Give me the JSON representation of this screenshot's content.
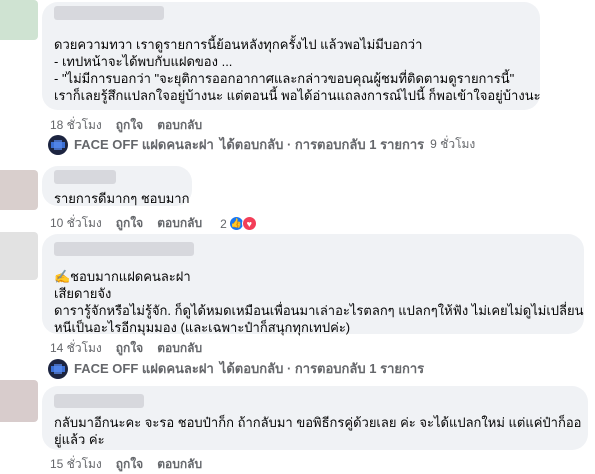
{
  "comments": [
    {
      "lines": [
        "ดวยความทวา เราดูรายการนี้ย้อนหลังทุกครั้งไป แล้วพอไม่มีบอกว่า",
        "- เทปหน้าจะได้พบกับแฝดของ ...",
        "- \"ไม่มีการบอกว่า \"จะยุติการออกอากาศและกล่าวขอบคุณผู้ชมที่ติดตามดูรายการนี้\"",
        "เราก็เลยรู้สึกแปลกใจอยู่บ้างนะ แต่ตอนนี้ พอได้อ่านแถลงการณ์ไปนี้ ก็พอเข้าใจอยู่บ้างนะ"
      ],
      "time": "18 ชั่วโมง",
      "like_label": "ถูกใจ",
      "reply_label": "ตอบกลับ",
      "reply_summary": {
        "page_name": "FACE OFF แฝดคนละฝา",
        "text": "ได้ตอบกลับ · การตอบกลับ 1 รายการ",
        "time": "9 ชั่วโมง"
      }
    },
    {
      "lines": [
        "รายการดีมากๆ ชอบมาก"
      ],
      "time": "10 ชั่วโมง",
      "like_label": "ถูกใจ",
      "reply_label": "ตอบกลับ",
      "reaction_count": "2"
    },
    {
      "lines": [
        "✍️ชอบมากแฝดคนละฝา",
        "เสียดายจัง",
        "ดารารู้จักหรือไม่รู้จัก. ก็ดูได้หมดเหมือนเพื่อนมาเล่าอะไรตลกๆ แปลกๆให้ฟัง ไม่เคยไม่ดูไม่เปลี่ยน",
        "หนีเป็นอะไรอีกมุมมอง (และเฉพาะป๋าก็สนุกทุกเทปค่ะ)"
      ],
      "time": "14 ชั่วโมง",
      "like_label": "ถูกใจ",
      "reply_label": "ตอบกลับ",
      "reply_summary": {
        "page_name": "FACE OFF แฝดคนละฝา",
        "text": "ได้ตอบกลับ · การตอบกลับ 1 รายการ",
        "time": ""
      }
    },
    {
      "lines": [
        "กลับมาอีกนะคะ จะรอ ชอบป๋าก็ก ถ้ากลับมา ขอพิธีกรคู่ด้วยเลย ค่ะ จะได้แปลกใหม่ แต่แค่ป๋าก็ออ",
        "ยู่แล้ว ค่ะ"
      ],
      "time": "15 ชั่วโมง",
      "like_label": "ถูกใจ",
      "reply_label": "ตอบกลับ"
    }
  ],
  "colors": {
    "bubble": "#f0f2f5",
    "muted": "#65676b",
    "like": "#1877f2",
    "love": "#f33e58"
  }
}
